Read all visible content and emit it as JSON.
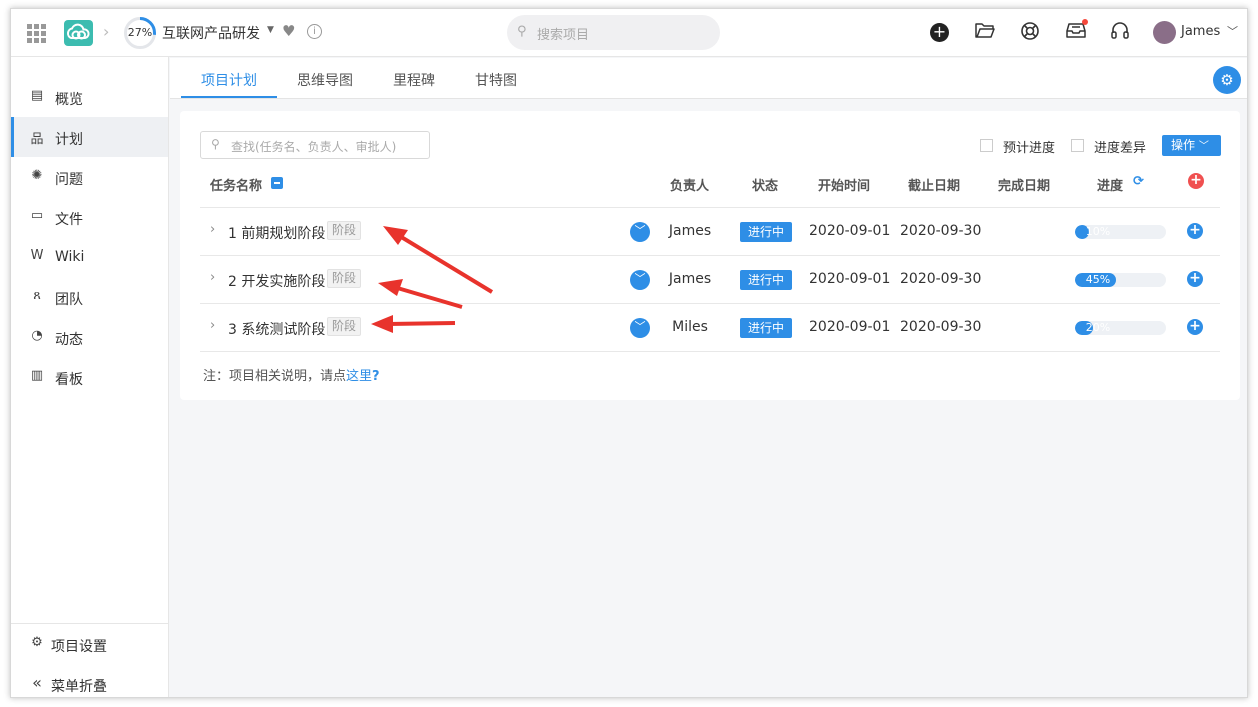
{
  "topbar": {
    "progress_label": "27%",
    "progress_value": 0.27,
    "project_name": "互联网产品研发",
    "search_placeholder": "搜索项目",
    "user_name": "James"
  },
  "sidebar": {
    "items": [
      {
        "label": "概览",
        "icon": "overview-icon",
        "glyph": "▤"
      },
      {
        "label": "计划",
        "icon": "plan-icon",
        "glyph": "品",
        "active": true
      },
      {
        "label": "问题",
        "icon": "bug-icon",
        "glyph": "✺"
      },
      {
        "label": "文件",
        "icon": "folder-icon",
        "glyph": "▭"
      },
      {
        "label": "Wiki",
        "icon": "wiki-icon",
        "glyph": "W"
      },
      {
        "label": "团队",
        "icon": "team-icon",
        "glyph": "ጸ"
      },
      {
        "label": "动态",
        "icon": "activity-icon",
        "glyph": "◔"
      },
      {
        "label": "看板",
        "icon": "board-icon",
        "glyph": "▥"
      }
    ],
    "settings_label": "项目设置",
    "collapse_label": "菜单折叠"
  },
  "tabs": [
    "项目计划",
    "思维导图",
    "里程碑",
    "甘特图"
  ],
  "toolbar": {
    "find_placeholder": "查找(任务名、负责人、审批人)",
    "planned_progress_label": "预计进度",
    "progress_diff_label": "进度差异",
    "operate_label": "操作"
  },
  "table": {
    "headers": {
      "name": "任务名称",
      "owner": "负责人",
      "status": "状态",
      "start": "开始时间",
      "due": "截止日期",
      "done": "完成日期",
      "progress": "进度"
    },
    "rows": [
      {
        "name": "1 前期规划阶段",
        "tag": "阶段",
        "owner": "James",
        "status": "进行中",
        "start": "2020-09-01",
        "due": "2020-09-30",
        "progress_label": "10%",
        "progress": 0.1
      },
      {
        "name": "2 开发实施阶段",
        "tag": "阶段",
        "owner": "James",
        "status": "进行中",
        "start": "2020-09-01",
        "due": "2020-09-30",
        "progress_label": "45%",
        "progress": 0.45
      },
      {
        "name": "3 系统测试阶段",
        "tag": "阶段",
        "owner": "Miles",
        "status": "进行中",
        "start": "2020-09-01",
        "due": "2020-09-30",
        "progress_label": "20%",
        "progress": 0.2
      }
    ]
  },
  "note": {
    "prefix": "注：项目相关说明，请点",
    "link": "这里",
    "suffix": "?"
  },
  "colors": {
    "accent": "#2e8ee6",
    "annotation_arrow": "#e8332c",
    "logo": "#3cbcb0"
  }
}
